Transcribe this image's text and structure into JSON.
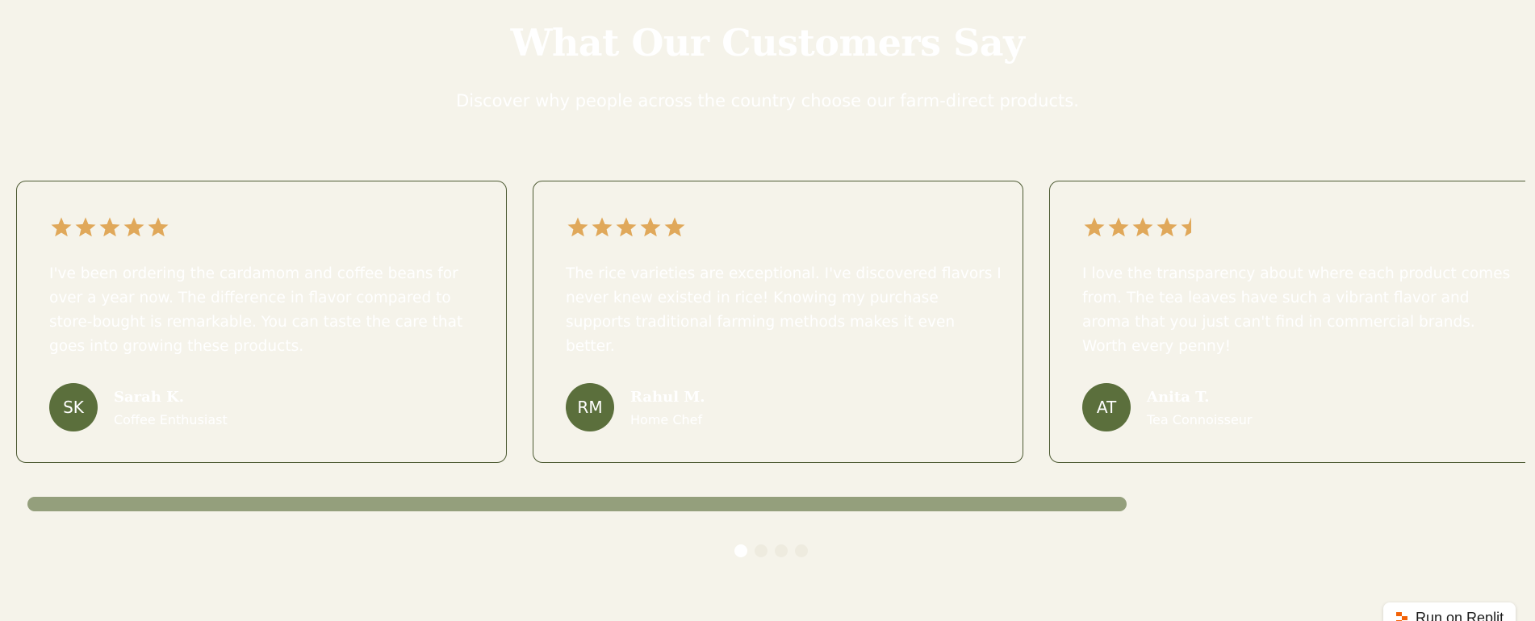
{
  "section": {
    "title": "What Our Customers Say",
    "subtitle": "Discover why people across the country choose our farm-direct products."
  },
  "colors": {
    "background": "#f5f3ea",
    "star": "#e0a85a",
    "avatar": "#5b6f3c",
    "card_border": "#4d5a33",
    "scrollbar": "#949f7c",
    "replit_brand": "#f26207"
  },
  "testimonials": [
    {
      "rating": 5,
      "quote": "I've been ordering the cardamom and coffee beans for over a year now. The difference in flavor compared to store-bought is remarkable. You can taste the care that goes into growing these products.",
      "initials": "SK",
      "name": "Sarah K.",
      "role": "Coffee Enthusiast"
    },
    {
      "rating": 5,
      "quote": "The rice varieties are exceptional. I've discovered flavors I never knew existed in rice! Knowing my purchase supports traditional farming methods makes it even better.",
      "initials": "RM",
      "name": "Rahul M.",
      "role": "Home Chef"
    },
    {
      "rating": 4.5,
      "quote": "I love the transparency about where each product comes from. The tea leaves have such a vibrant flavor and aroma that you just can't find in commercial brands. Worth every penny!",
      "initials": "AT",
      "name": "Anita T.",
      "role": "Tea Connoisseur"
    }
  ],
  "carousel": {
    "scroll_fraction": 0.734,
    "dots": 4,
    "active_dot": 0
  },
  "replit_badge": {
    "label": "Run on Replit",
    "icon": "replit-logo-icon"
  }
}
